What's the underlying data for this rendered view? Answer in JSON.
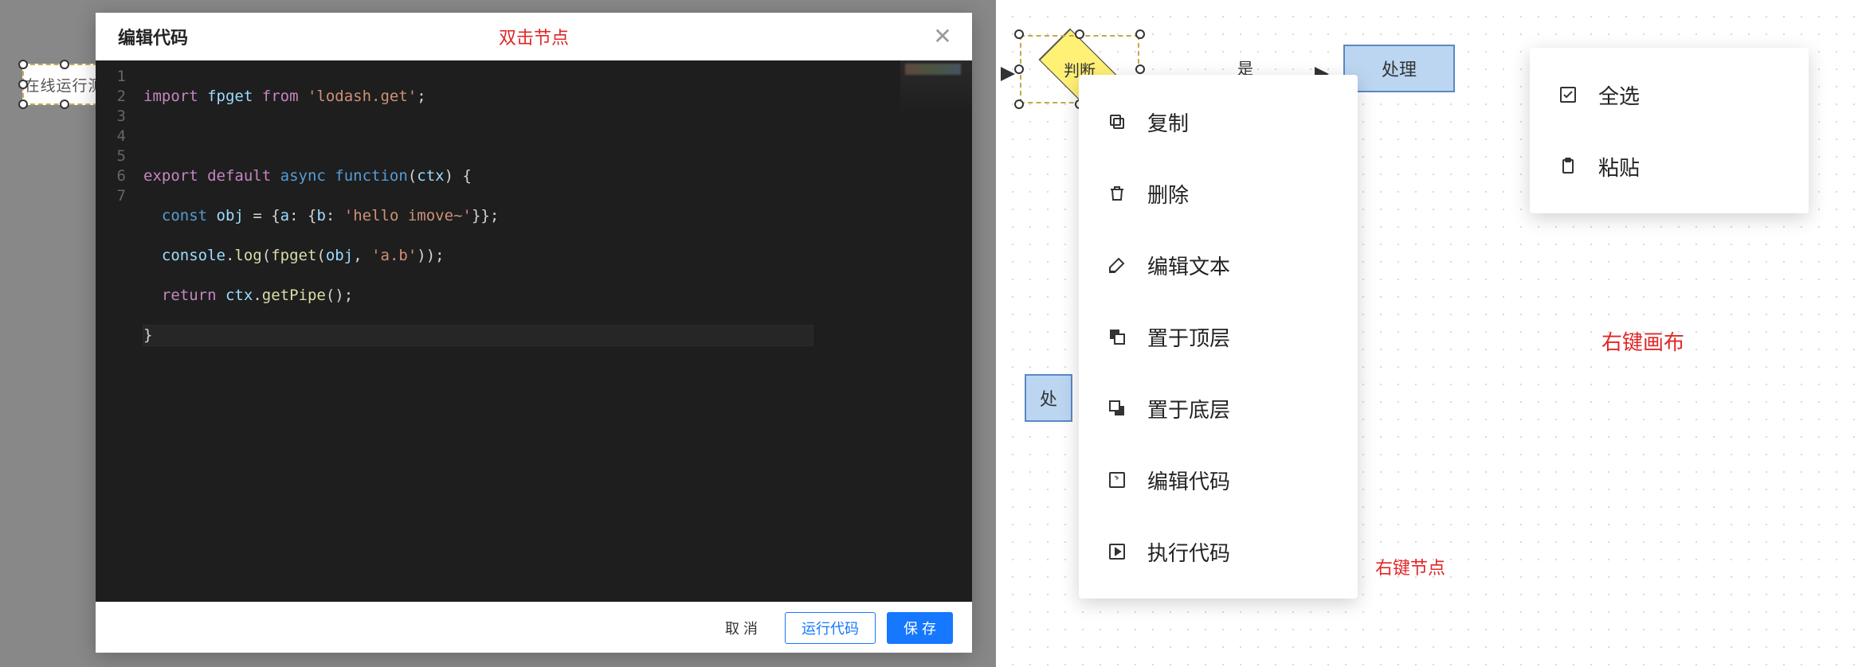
{
  "modal": {
    "title": "编辑代码",
    "annotation": "双击节点",
    "buttons": {
      "cancel": "取 消",
      "run": "运行代码",
      "save": "保 存"
    }
  },
  "editor": {
    "line_numbers": [
      "1",
      "2",
      "3",
      "4",
      "5",
      "6",
      "7"
    ],
    "lines_raw": [
      "import fpget from 'lodash.get';",
      "",
      "export default async function(ctx) {",
      "  const obj = {a: {b: 'hello imove~'}};",
      "  console.log(fpget(obj, 'a.b'));",
      "  return ctx.getPipe();",
      "}"
    ]
  },
  "back_node_label": "在线运行测",
  "canvas": {
    "diamond_label": "判断",
    "proc_label": "处理",
    "proc_left_label": "处",
    "edge_yes": "是"
  },
  "node_menu": {
    "items": [
      {
        "icon": "copy",
        "label": "复制"
      },
      {
        "icon": "delete",
        "label": "删除"
      },
      {
        "icon": "edit-text",
        "label": "编辑文本"
      },
      {
        "icon": "bring-front",
        "label": "置于顶层"
      },
      {
        "icon": "send-back",
        "label": "置于底层"
      },
      {
        "icon": "edit-code",
        "label": "编辑代码"
      },
      {
        "icon": "run-code",
        "label": "执行代码"
      }
    ],
    "note": "右键节点"
  },
  "canvas_menu": {
    "items": [
      {
        "icon": "select-all",
        "label": "全选"
      },
      {
        "icon": "paste",
        "label": "粘贴"
      }
    ],
    "note": "右键画布"
  }
}
